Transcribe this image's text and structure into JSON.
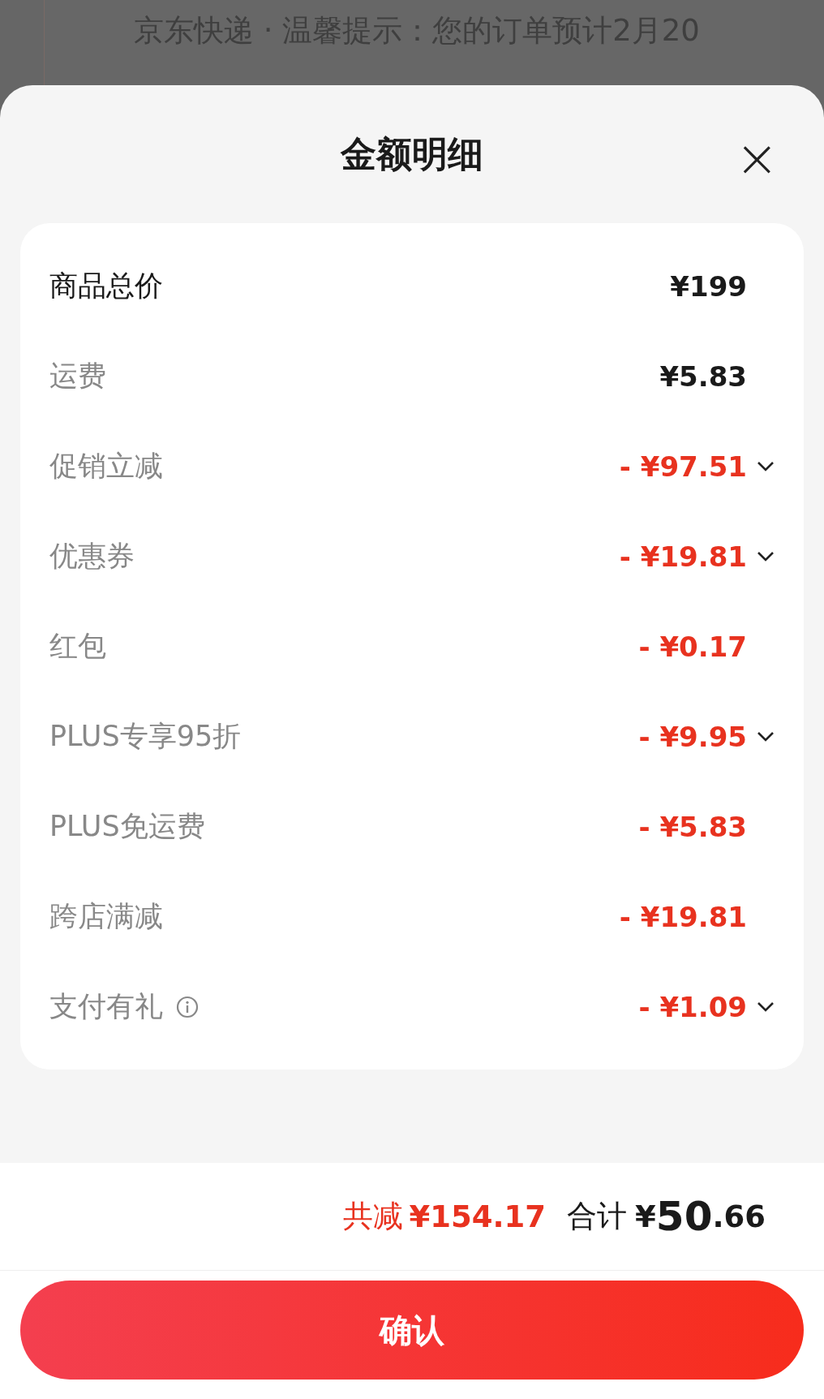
{
  "background": {
    "lines": [
      "京东快递 · 温馨提示：您的订单预计2月20"
    ]
  },
  "sheet": {
    "title": "金额明细",
    "close": "×"
  },
  "rows": [
    {
      "label": "商品总价",
      "value": "¥199",
      "primary": true,
      "discount": false,
      "expandable": false,
      "info": false
    },
    {
      "label": "运费",
      "value": "¥5.83",
      "primary": false,
      "discount": false,
      "expandable": false,
      "info": false
    },
    {
      "label": "促销立减",
      "value": "- ¥97.51",
      "primary": false,
      "discount": true,
      "expandable": true,
      "info": false
    },
    {
      "label": "优惠券",
      "value": "- ¥19.81",
      "primary": false,
      "discount": true,
      "expandable": true,
      "info": false
    },
    {
      "label": "红包",
      "value": "- ¥0.17",
      "primary": false,
      "discount": true,
      "expandable": false,
      "info": false
    },
    {
      "label": "PLUS专享95折",
      "value": "- ¥9.95",
      "primary": false,
      "discount": true,
      "expandable": true,
      "info": false
    },
    {
      "label": "PLUS免运费",
      "value": "- ¥5.83",
      "primary": false,
      "discount": true,
      "expandable": false,
      "info": false
    },
    {
      "label": "跨店满减",
      "value": "- ¥19.81",
      "primary": false,
      "discount": true,
      "expandable": false,
      "info": false
    },
    {
      "label": "支付有礼",
      "value": "- ¥1.09",
      "primary": false,
      "discount": true,
      "expandable": true,
      "info": true
    }
  ],
  "footer": {
    "saved_label": "共减",
    "saved_value": "¥154.17",
    "total_label": "合计",
    "total_currency": "¥",
    "total_integer": "50",
    "total_decimal": ".66",
    "confirm": "确认"
  }
}
